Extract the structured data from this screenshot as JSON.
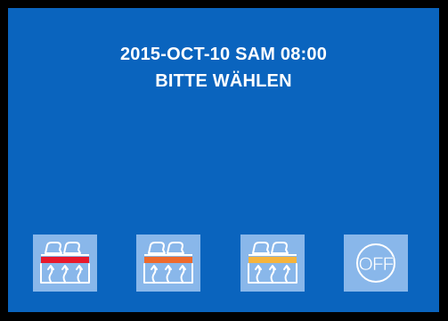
{
  "display": {
    "datetime": "2015-OCT-10 SAM 08:00",
    "prompt": "BITTE WÄHLEN"
  },
  "buttons": [
    {
      "name": "heat-level-high",
      "icon": "seat-heat-icon",
      "bar_color": "#E8192C"
    },
    {
      "name": "heat-level-medium",
      "icon": "seat-heat-icon",
      "bar_color": "#EE6A2C"
    },
    {
      "name": "heat-level-low",
      "icon": "seat-heat-icon",
      "bar_color": "#F6B43C"
    },
    {
      "name": "off",
      "icon": "off-icon",
      "label": "OFF"
    }
  ],
  "colors": {
    "screen_background": "#0A64BE",
    "button_background": "#89B7EA",
    "icon_stroke": "#FFFFFF"
  }
}
